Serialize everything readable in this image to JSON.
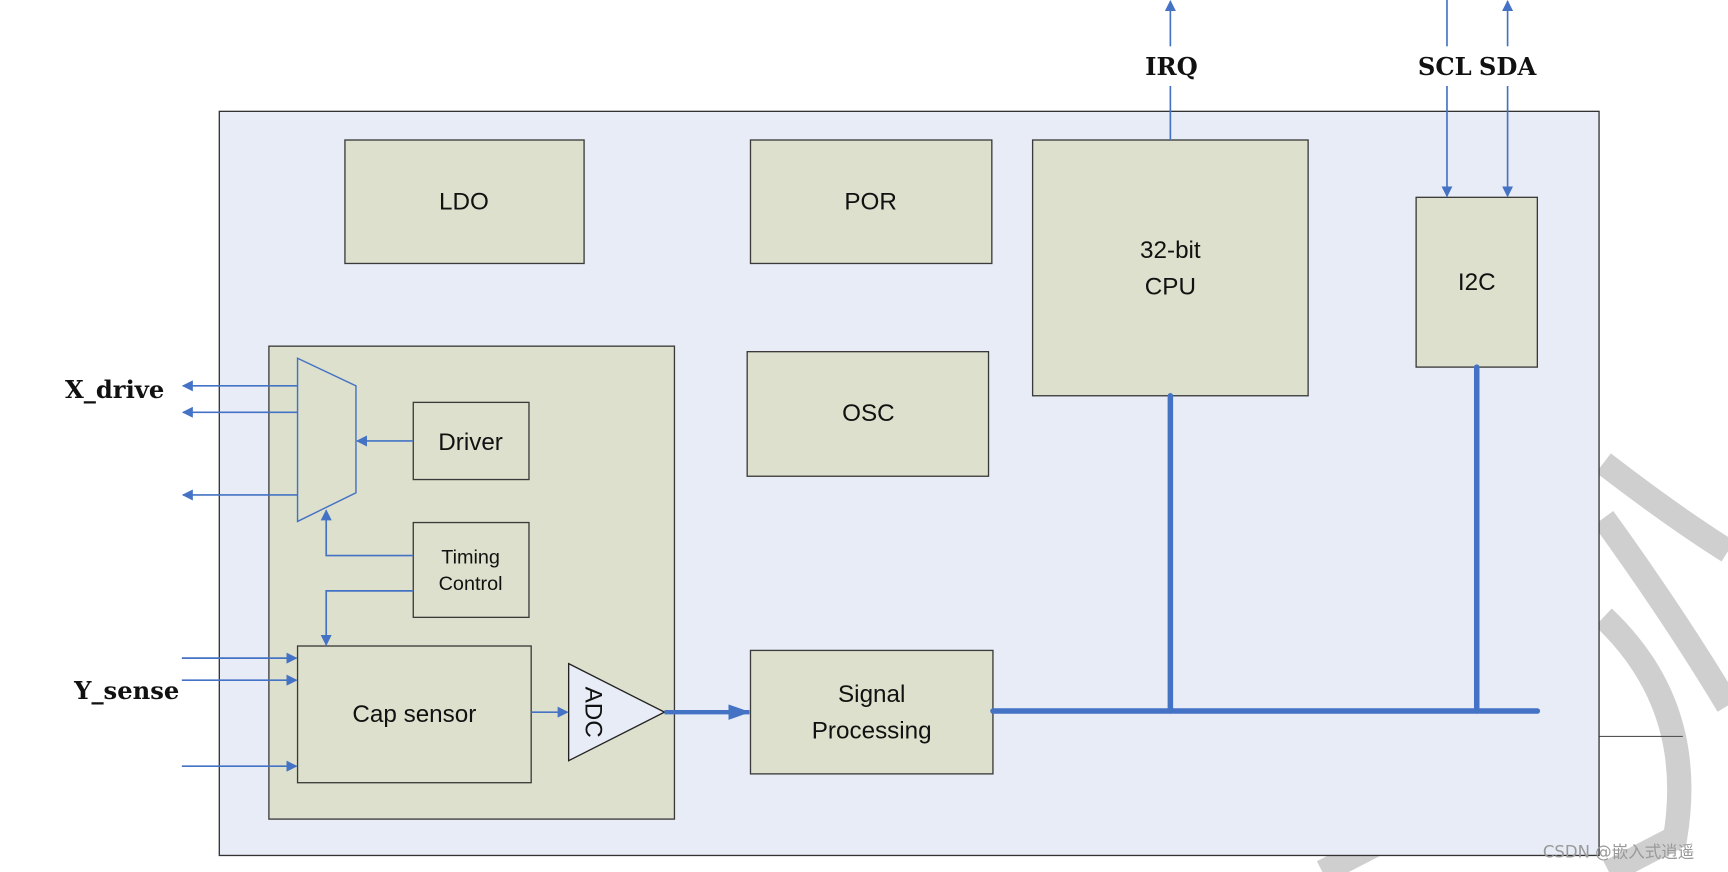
{
  "blocks": {
    "ldo": "LDO",
    "por": "POR",
    "cpu_line1": "32-bit",
    "cpu_line2": "CPU",
    "i2c": "I2C",
    "osc": "OSC",
    "driver": "Driver",
    "timing_line1": "Timing",
    "timing_line2": "Control",
    "cap_sensor": "Cap sensor",
    "adc": "ADC",
    "signal_line1": "Signal",
    "signal_line2": "Processing"
  },
  "signals": {
    "irq": "IRQ",
    "scl": "SCL",
    "sda": "SDA",
    "x_drive": "X_drive",
    "y_sense": "Y_sense"
  },
  "colors": {
    "chip_background": "#e8ecf7",
    "block_fill": "#dde0cc",
    "wire": "#4472c4"
  },
  "watermark": "CSDN @嵌入式逍遥"
}
